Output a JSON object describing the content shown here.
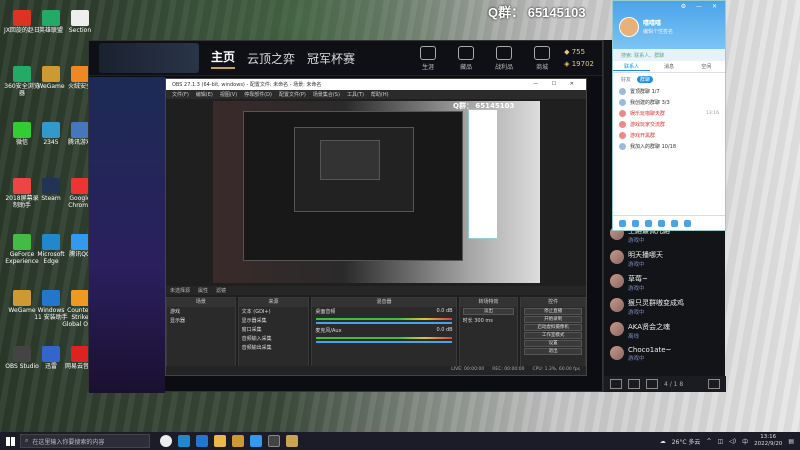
{
  "desktop": {
    "qq_number_overlay": "Q群：  65145103",
    "icons": [
      {
        "label": "JX回旋的赵日",
        "color": "#d32"
      },
      {
        "label": "英雄联盟",
        "color": "#2a6"
      },
      {
        "label": "Section",
        "color": "#eee"
      },
      {
        "label": "360安全浏览器",
        "color": "#2a6"
      },
      {
        "label": "WeGame",
        "color": "#c93"
      },
      {
        "label": "火绒安全",
        "color": "#e82"
      },
      {
        "label": "微信",
        "color": "#3c3"
      },
      {
        "label": "2345",
        "color": "#39c"
      },
      {
        "label": "腾讯游戏",
        "color": "#47b"
      },
      {
        "label": "2018屏幕录制助手",
        "color": "#e44"
      },
      {
        "label": "Steam",
        "color": "#235"
      },
      {
        "label": "Google Chrome",
        "color": "#e33"
      },
      {
        "label": "GeForce Experience",
        "color": "#4b4"
      },
      {
        "label": "Microsoft Edge",
        "color": "#28c"
      },
      {
        "label": "腾讯QQ",
        "color": "#39e"
      },
      {
        "label": "WeGame",
        "color": "#c93"
      },
      {
        "label": "Windows 11 安装助手",
        "color": "#27c"
      },
      {
        "label": "Counter-Strike Global Off...",
        "color": "#e92"
      },
      {
        "label": "OBS Studio",
        "color": "#444"
      },
      {
        "label": "迅雷",
        "color": "#36c"
      },
      {
        "label": "网易云音乐",
        "color": "#d22"
      }
    ]
  },
  "game_client": {
    "nav": [
      "主页",
      "云顶之弈",
      "冠军杯赛"
    ],
    "icons": [
      "生涯",
      "藏品",
      "战利品",
      "商城"
    ],
    "currency": {
      "blue_essence": "755",
      "rp": "19702"
    }
  },
  "obs": {
    "title": "OBS 27.1.3 (64-bit, windows) - 配置文件: 未命名 - 场景: 未命名",
    "menu": [
      "文件(F)",
      "编辑(E)",
      "视图(V)",
      "停靠部件(D)",
      "配置文件(P)",
      "场景集合(S)",
      "工具(T)",
      "帮助(H)"
    ],
    "preview_overlay_number": "Q群： 65145103",
    "toolbar": [
      "未选择源",
      "属性",
      "滤镜"
    ],
    "docks": {
      "scenes": {
        "title": "场景",
        "items": [
          "游戏",
          "显示器"
        ]
      },
      "sources": {
        "title": "来源",
        "items": [
          "文本 (GDI+)",
          "显示器采集",
          "窗口采集",
          "音频输入采集",
          "音频输出采集"
        ]
      },
      "mixer": {
        "title": "混音器",
        "channels": [
          {
            "name": "桌面音频",
            "level": "0.0 dB"
          },
          {
            "name": "麦克风/Aux",
            "level": "0.0 dB"
          }
        ]
      },
      "transitions": {
        "title": "转场特效",
        "type": "淡出",
        "duration_label": "时长",
        "duration": "300 ms"
      },
      "controls": {
        "title": "控件",
        "buttons": [
          "停止直播",
          "开始录制",
          "启动虚拟摄像机",
          "工作室模式",
          "设置",
          "退出"
        ]
      }
    },
    "status": [
      "LIVE: 00:00:00",
      "REC: 00:00:00",
      "CPU: 1.3%, 60.00 fps"
    ]
  },
  "chat": {
    "messages": [
      {
        "name": "上路最佩儿路",
        "sub": "游戏中"
      },
      {
        "name": "明天播哪天",
        "sub": "游戏中"
      },
      {
        "name": "草莓~",
        "sub": "游戏中"
      },
      {
        "name": "狠只灵群嗷变成鸡",
        "sub": "游戏中"
      },
      {
        "name": "AKA贤会之魂",
        "sub": "离线"
      },
      {
        "name": "Choco1ate~",
        "sub": "游戏中"
      }
    ],
    "bottom_counter": "4 / 1 8"
  },
  "qq_panel": {
    "name": "嘻嘻嘻",
    "signature": "编辑个性签名",
    "search": "搜索: 联系人、群聊",
    "tabs": [
      "联系人",
      "消息",
      "空间"
    ],
    "subtabs": [
      "好友",
      "群聊"
    ],
    "rows": [
      {
        "label": "置顶群聊 1/7",
        "time": "",
        "red": false
      },
      {
        "label": "我创建的群聊 3/3",
        "time": "",
        "red": false
      },
      {
        "label": "娱乐玩咖聊天群",
        "time": "13:16",
        "red": true
      },
      {
        "label": "游戏玩家交流群",
        "time": "",
        "red": true
      },
      {
        "label": "游戏开黑群",
        "time": "",
        "red": true
      },
      {
        "label": "我加入的群聊 10/18",
        "time": "",
        "red": false
      }
    ]
  },
  "taskbar": {
    "search_placeholder": "在这里输入你要搜索的内容",
    "weather": "26°C 多云",
    "time": "13:16",
    "date": "2022/9/20",
    "lang": "中"
  }
}
